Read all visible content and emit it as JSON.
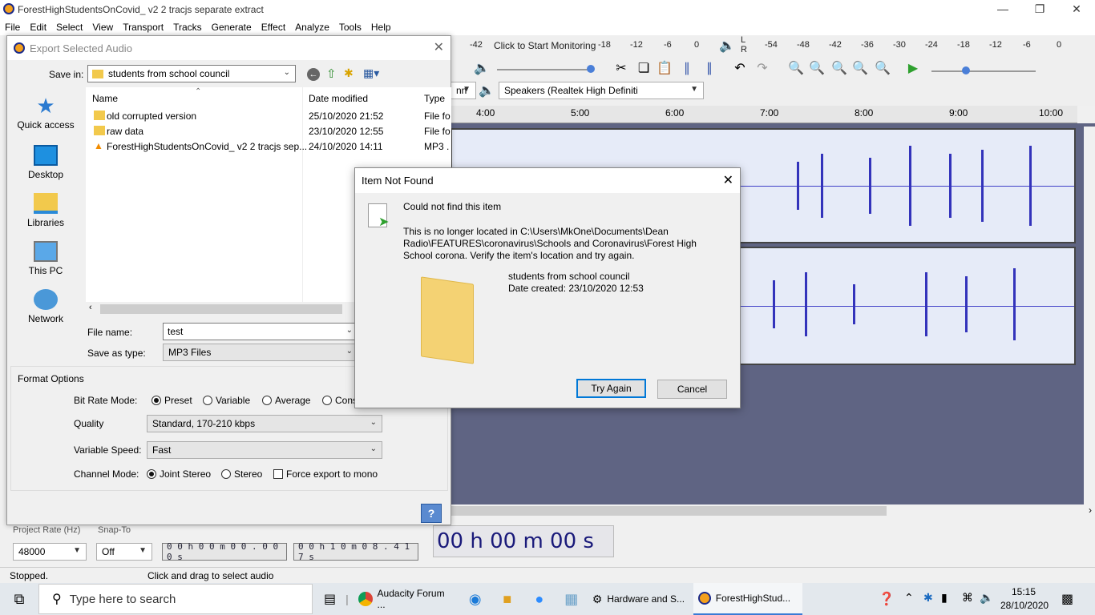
{
  "window": {
    "title": "ForestHighStudentsOnCovid_ v2 2 tracjs separate extract"
  },
  "menu": [
    "File",
    "Edit",
    "Select",
    "View",
    "Transport",
    "Tracks",
    "Generate",
    "Effect",
    "Analyze",
    "Tools",
    "Help"
  ],
  "meters": {
    "rec_scale": [
      "-42",
      "-18",
      "-12",
      "-6",
      "0"
    ],
    "click_monitor": "Click to Start Monitoring",
    "play_scale": [
      "-54",
      "-48",
      "-42",
      "-36",
      "-30",
      "-24",
      "-18",
      "-12",
      "-6",
      "0"
    ],
    "lr": [
      "L",
      "R"
    ]
  },
  "device": {
    "host_partial": "nn",
    "output": "Speakers (Realtek High Definiti"
  },
  "timeline": {
    "ticks": [
      "4:00",
      "5:00",
      "6:00",
      "7:00",
      "8:00",
      "9:00",
      "10:00"
    ]
  },
  "bottom": {
    "project_rate_label": "Project Rate (Hz)",
    "snap_label": "Snap-To",
    "rate": "48000",
    "snap": "Off",
    "sel_start": "0 0 h 0 0 m 0 0 . 0 0 0 s",
    "sel_end": "0 0 h 1 0 m 0 8 . 4 1 7 s",
    "big_time": "00 h 00 m 00 s"
  },
  "status": {
    "left": "Stopped.",
    "hint": "Click and drag to select audio"
  },
  "export": {
    "title": "Export Selected Audio",
    "save_in_label": "Save in:",
    "save_in": "students from school council",
    "places": [
      "Quick access",
      "Desktop",
      "Libraries",
      "This PC",
      "Network"
    ],
    "columns": [
      "Name",
      "Date modified",
      "Type"
    ],
    "files": [
      {
        "name": "old corrupted version",
        "date": "25/10/2020 21:52",
        "type": "File fo"
      },
      {
        "name": "raw data",
        "date": "23/10/2020 12:55",
        "type": "File fo"
      },
      {
        "name": "ForestHighStudentsOnCovid_ v2 2 tracjs sep...",
        "date": "24/10/2020 14:11",
        "type": "MP3 ."
      }
    ],
    "filename_label": "File name:",
    "filename": "test",
    "type_label": "Save as type:",
    "type": "MP3 Files",
    "format_options": "Format Options",
    "bitrate_label": "Bit Rate Mode:",
    "bitrate_modes": [
      "Preset",
      "Variable",
      "Average",
      "Cons"
    ],
    "quality_label": "Quality",
    "quality": "Standard, 170-210 kbps",
    "varspeed_label": "Variable Speed:",
    "varspeed": "Fast",
    "channel_label": "Channel Mode:",
    "channel_modes": [
      "Joint Stereo",
      "Stereo"
    ],
    "force_mono": "Force export to mono",
    "help": "?"
  },
  "notfound": {
    "title": "Item Not Found",
    "heading": "Could not find this item",
    "message": "This is no longer located in C:\\Users\\MkOne\\Documents\\Dean Radio\\FEATURES\\coronavirus\\Schools and Coronavirus\\Forest High School corona. Verify the item's location and try again.",
    "item_name": "students from school council",
    "item_date": "Date created: 23/10/2020 12:53",
    "try_again": "Try Again",
    "cancel": "Cancel"
  },
  "taskbar": {
    "search": "Type here to search",
    "apps": [
      "Audacity Forum ...",
      "Hardware and S...",
      "ForestHighStud..."
    ],
    "time": "15:15",
    "date": "28/10/2020"
  }
}
